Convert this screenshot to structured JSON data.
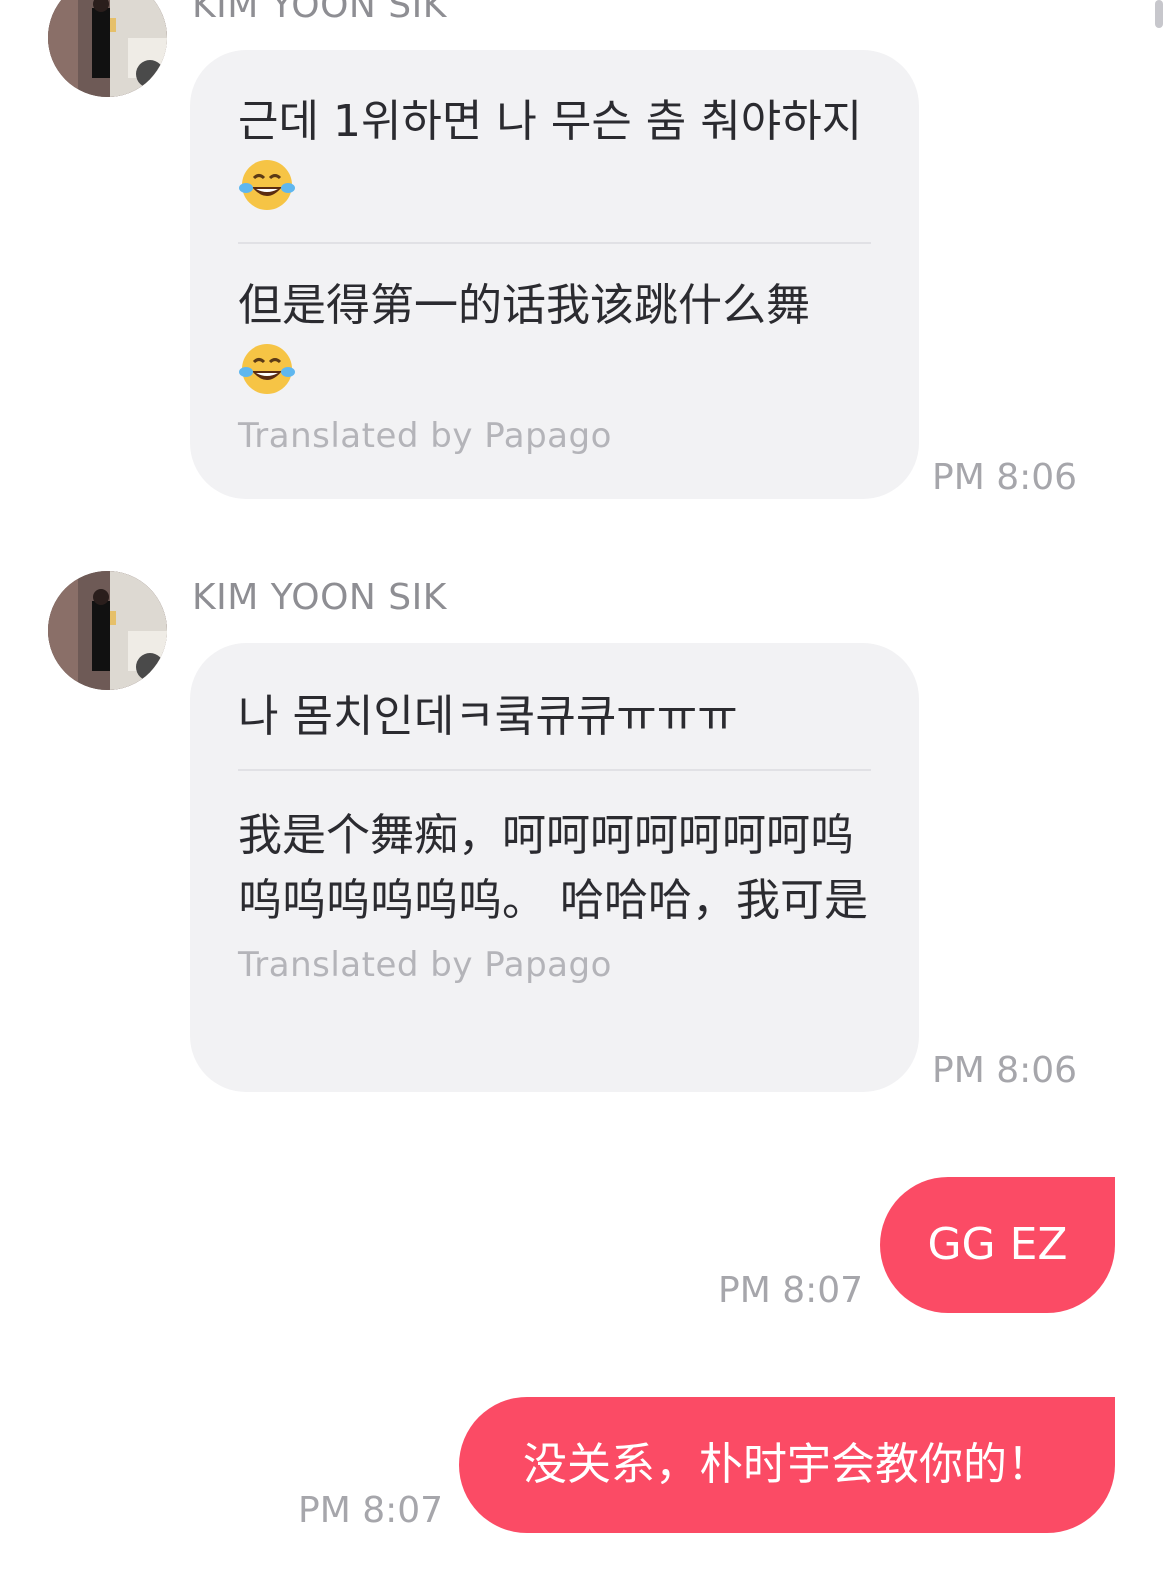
{
  "colors": {
    "incoming_bubble": "#f2f2f4",
    "outgoing_bubble": "#fb4b65",
    "timestamp": "#a6a6ab",
    "sender_name": "#8e8e93"
  },
  "messages": [
    {
      "sender": "KIM YOON SIK",
      "original": "근데 1위하면 나 무슨 춤 춰야하지",
      "original_emoji": "face-with-tears-of-joy-icon",
      "translated": "但是得第一的话我该跳什么舞",
      "translated_emoji": "face-with-tears-of-joy-icon",
      "translated_by": "Translated by Papago",
      "time": "PM 8:06"
    },
    {
      "sender": "KIM YOON SIK",
      "original": "나 몸치인데ㅋ쿸큐큐ㅠㅠㅠ",
      "translated": "我是个舞痴，呵呵呵呵呵呵呵呜呜呜呜呜呜呜。 哈哈哈，我可是",
      "translated_by": "Translated by Papago",
      "time": "PM 8:06"
    },
    {
      "sender": "me",
      "text": "GG EZ",
      "time": "PM 8:07"
    },
    {
      "sender": "me",
      "text": "没关系，朴时宇会教你的！",
      "time": "PM 8:07"
    }
  ]
}
